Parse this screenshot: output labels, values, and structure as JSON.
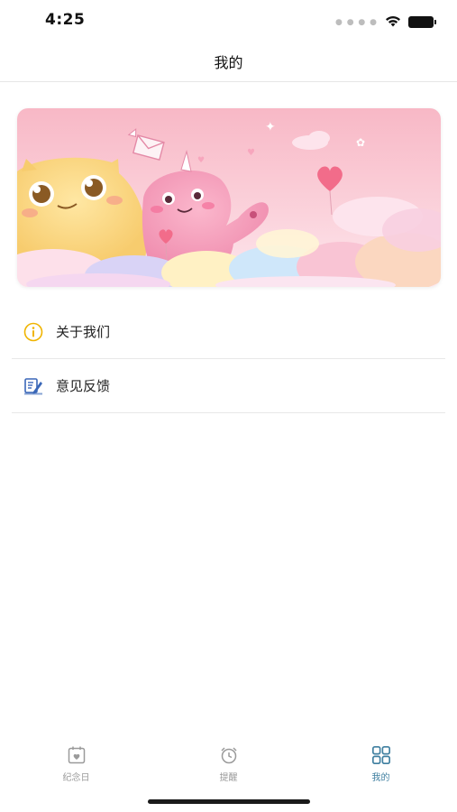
{
  "status_bar": {
    "time": "4:25",
    "icons": [
      "signal-dots-icon",
      "wifi-icon",
      "battery-icon"
    ]
  },
  "nav": {
    "title": "我的"
  },
  "banner": {
    "description_icon": "cartoon-monsters-banner"
  },
  "menu": {
    "items": [
      {
        "label": "关于我们",
        "icon": "info-circle-icon",
        "icon_color": "#f0b400"
      },
      {
        "label": "意见反馈",
        "icon": "feedback-edit-icon",
        "icon_color": "#3a67b8"
      }
    ]
  },
  "tab_bar": {
    "tabs": [
      {
        "label": "纪念日",
        "icon": "calendar-heart-icon",
        "active": false
      },
      {
        "label": "提醒",
        "icon": "alarm-clock-icon",
        "active": false
      },
      {
        "label": "我的",
        "icon": "grid-icon",
        "active": true
      }
    ],
    "active_color": "#3f7fa0",
    "inactive_color": "#999999"
  }
}
